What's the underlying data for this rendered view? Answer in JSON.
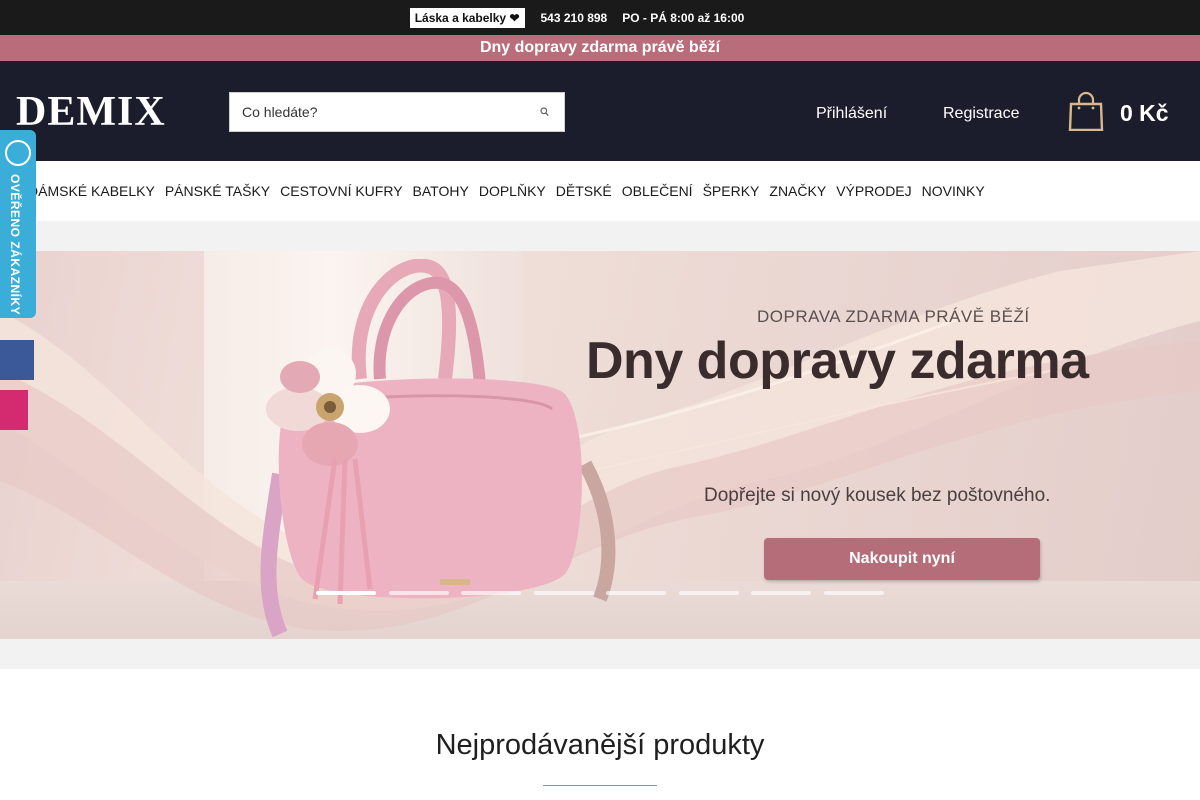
{
  "topbar": {
    "tag": "Láska a kabelky ❤",
    "phone": "543 210 898",
    "hours": "PO - PÁ 8:00 až 16:00",
    "social_icons": [
      "facebook-icon",
      "instagram-icon"
    ],
    "icon_glyph": ""
  },
  "promo": {
    "text": "Dny dopravy zdarma právě běží"
  },
  "header": {
    "logo": "DEMIX",
    "search_placeholder": "Co hledáte?",
    "login": "Přihlášení",
    "register": "Registrace",
    "cart_total": "0 Kč",
    "icon_glyph": ""
  },
  "nav": {
    "items": [
      "DÁMSKÉ KABELKY",
      "PÁNSKÉ TAŠKY",
      "CESTOVNÍ KUFRY",
      "BATOHY",
      "DOPLŇKY",
      "DĚTSKÉ",
      "OBLEČENÍ",
      "ŠPERKY",
      "ZNAČKY",
      "VÝPRODEJ",
      "NOVINKY"
    ]
  },
  "hero": {
    "kicker": "DOPRAVA ZDARMA PRÁVĚ BĚŽÍ",
    "headline": "Dny dopravy zdarma",
    "subtext": "Dopřejte si nový kousek bez poštovného.",
    "cta": "Nakoupit nyní",
    "slide_count": 8,
    "active_slide": 1
  },
  "side": {
    "verified_label": "OVĚŘENO ZÁKAZNÍKY",
    "facebook_glyph": "",
    "instagram_glyph": ""
  },
  "bestsellers": {
    "title": "Nejprodávanější produkty"
  },
  "colors": {
    "topbar": "#1a1a1a",
    "promo": "#b96d7a",
    "header": "#1b1d2d",
    "cart_bag": "#d9b98a",
    "cta": "#b56d79",
    "verified": "#3aaed8",
    "facebook": "#3b5998",
    "instagram": "#d42a6f"
  }
}
